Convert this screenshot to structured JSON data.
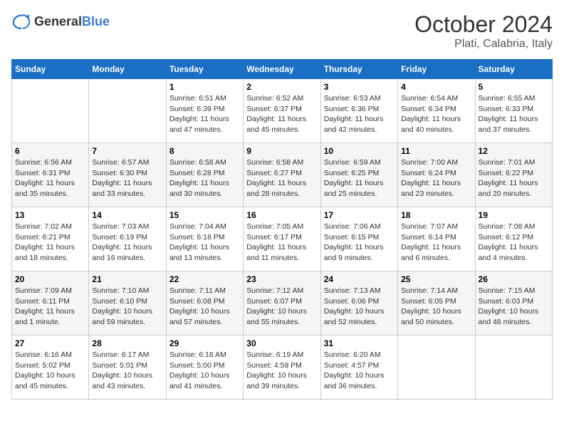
{
  "header": {
    "logo_general": "General",
    "logo_blue": "Blue",
    "month": "October 2024",
    "location": "Plati, Calabria, Italy"
  },
  "days_of_week": [
    "Sunday",
    "Monday",
    "Tuesday",
    "Wednesday",
    "Thursday",
    "Friday",
    "Saturday"
  ],
  "weeks": [
    [
      {
        "day": "",
        "info": ""
      },
      {
        "day": "",
        "info": ""
      },
      {
        "day": "1",
        "info": "Sunrise: 6:51 AM\nSunset: 6:39 PM\nDaylight: 11 hours and 47 minutes."
      },
      {
        "day": "2",
        "info": "Sunrise: 6:52 AM\nSunset: 6:37 PM\nDaylight: 11 hours and 45 minutes."
      },
      {
        "day": "3",
        "info": "Sunrise: 6:53 AM\nSunset: 6:36 PM\nDaylight: 11 hours and 42 minutes."
      },
      {
        "day": "4",
        "info": "Sunrise: 6:54 AM\nSunset: 6:34 PM\nDaylight: 11 hours and 40 minutes."
      },
      {
        "day": "5",
        "info": "Sunrise: 6:55 AM\nSunset: 6:33 PM\nDaylight: 11 hours and 37 minutes."
      }
    ],
    [
      {
        "day": "6",
        "info": "Sunrise: 6:56 AM\nSunset: 6:31 PM\nDaylight: 11 hours and 35 minutes."
      },
      {
        "day": "7",
        "info": "Sunrise: 6:57 AM\nSunset: 6:30 PM\nDaylight: 11 hours and 33 minutes."
      },
      {
        "day": "8",
        "info": "Sunrise: 6:58 AM\nSunset: 6:28 PM\nDaylight: 11 hours and 30 minutes."
      },
      {
        "day": "9",
        "info": "Sunrise: 6:58 AM\nSunset: 6:27 PM\nDaylight: 11 hours and 28 minutes."
      },
      {
        "day": "10",
        "info": "Sunrise: 6:59 AM\nSunset: 6:25 PM\nDaylight: 11 hours and 25 minutes."
      },
      {
        "day": "11",
        "info": "Sunrise: 7:00 AM\nSunset: 6:24 PM\nDaylight: 11 hours and 23 minutes."
      },
      {
        "day": "12",
        "info": "Sunrise: 7:01 AM\nSunset: 6:22 PM\nDaylight: 11 hours and 20 minutes."
      }
    ],
    [
      {
        "day": "13",
        "info": "Sunrise: 7:02 AM\nSunset: 6:21 PM\nDaylight: 11 hours and 18 minutes."
      },
      {
        "day": "14",
        "info": "Sunrise: 7:03 AM\nSunset: 6:19 PM\nDaylight: 11 hours and 16 minutes."
      },
      {
        "day": "15",
        "info": "Sunrise: 7:04 AM\nSunset: 6:18 PM\nDaylight: 11 hours and 13 minutes."
      },
      {
        "day": "16",
        "info": "Sunrise: 7:05 AM\nSunset: 6:17 PM\nDaylight: 11 hours and 11 minutes."
      },
      {
        "day": "17",
        "info": "Sunrise: 7:06 AM\nSunset: 6:15 PM\nDaylight: 11 hours and 9 minutes."
      },
      {
        "day": "18",
        "info": "Sunrise: 7:07 AM\nSunset: 6:14 PM\nDaylight: 11 hours and 6 minutes."
      },
      {
        "day": "19",
        "info": "Sunrise: 7:08 AM\nSunset: 6:12 PM\nDaylight: 11 hours and 4 minutes."
      }
    ],
    [
      {
        "day": "20",
        "info": "Sunrise: 7:09 AM\nSunset: 6:11 PM\nDaylight: 11 hours and 1 minute."
      },
      {
        "day": "21",
        "info": "Sunrise: 7:10 AM\nSunset: 6:10 PM\nDaylight: 10 hours and 59 minutes."
      },
      {
        "day": "22",
        "info": "Sunrise: 7:11 AM\nSunset: 6:08 PM\nDaylight: 10 hours and 57 minutes."
      },
      {
        "day": "23",
        "info": "Sunrise: 7:12 AM\nSunset: 6:07 PM\nDaylight: 10 hours and 55 minutes."
      },
      {
        "day": "24",
        "info": "Sunrise: 7:13 AM\nSunset: 6:06 PM\nDaylight: 10 hours and 52 minutes."
      },
      {
        "day": "25",
        "info": "Sunrise: 7:14 AM\nSunset: 6:05 PM\nDaylight: 10 hours and 50 minutes."
      },
      {
        "day": "26",
        "info": "Sunrise: 7:15 AM\nSunset: 6:03 PM\nDaylight: 10 hours and 48 minutes."
      }
    ],
    [
      {
        "day": "27",
        "info": "Sunrise: 6:16 AM\nSunset: 5:02 PM\nDaylight: 10 hours and 45 minutes."
      },
      {
        "day": "28",
        "info": "Sunrise: 6:17 AM\nSunset: 5:01 PM\nDaylight: 10 hours and 43 minutes."
      },
      {
        "day": "29",
        "info": "Sunrise: 6:18 AM\nSunset: 5:00 PM\nDaylight: 10 hours and 41 minutes."
      },
      {
        "day": "30",
        "info": "Sunrise: 6:19 AM\nSunset: 4:59 PM\nDaylight: 10 hours and 39 minutes."
      },
      {
        "day": "31",
        "info": "Sunrise: 6:20 AM\nSunset: 4:57 PM\nDaylight: 10 hours and 36 minutes."
      },
      {
        "day": "",
        "info": ""
      },
      {
        "day": "",
        "info": ""
      }
    ]
  ]
}
